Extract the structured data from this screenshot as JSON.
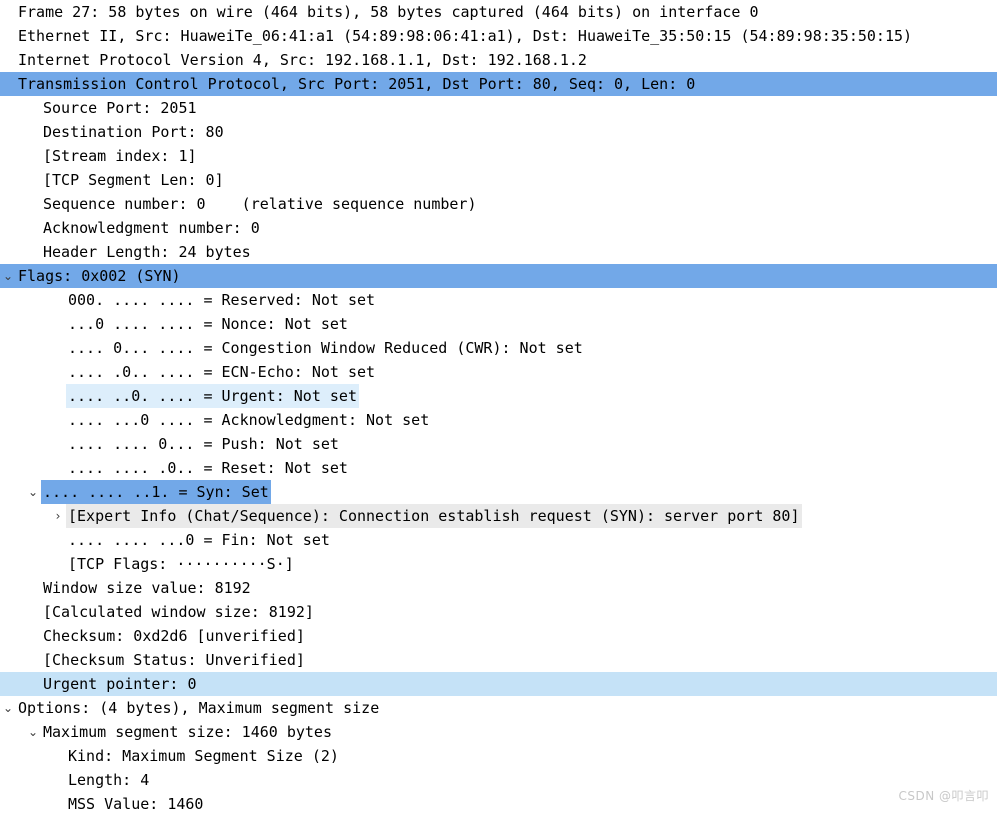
{
  "app": {
    "pane": "packet-details",
    "watermark": "CSDN @叩言叩"
  },
  "colors": {
    "selection_blue": "#72a8e8",
    "highlight_light_blue": "#c5e2f7",
    "highlight_pale_blue": "#ddeefb",
    "expert_gray": "#eaeaea",
    "text": "#000000",
    "background": "#ffffff"
  },
  "icons": {
    "expanded": "⌄",
    "collapsed": "›"
  },
  "rows": [
    {
      "id": "frame",
      "indent": 0,
      "twisty": "none",
      "highlight": "none",
      "text": "Frame 27: 58 bytes on wire (464 bits), 58 bytes captured (464 bits) on interface 0"
    },
    {
      "id": "ethernet",
      "indent": 0,
      "twisty": "none",
      "highlight": "none",
      "text": "Ethernet II, Src: HuaweiTe_06:41:a1 (54:89:98:06:41:a1), Dst: HuaweiTe_35:50:15 (54:89:98:35:50:15)"
    },
    {
      "id": "ipv4",
      "indent": 0,
      "twisty": "none",
      "highlight": "none",
      "text": "Internet Protocol Version 4, Src: 192.168.1.1, Dst: 192.168.1.2"
    },
    {
      "id": "tcp",
      "indent": 0,
      "twisty": "none",
      "highlight": "selected-full",
      "text": "Transmission Control Protocol, Src Port: 2051, Dst Port: 80, Seq: 0, Len: 0"
    },
    {
      "id": "source-port",
      "indent": 1,
      "twisty": "none",
      "highlight": "none",
      "text": "Source Port: 2051"
    },
    {
      "id": "destination-port",
      "indent": 1,
      "twisty": "none",
      "highlight": "none",
      "text": "Destination Port: 80"
    },
    {
      "id": "stream-index",
      "indent": 1,
      "twisty": "none",
      "highlight": "none",
      "text": "[Stream index: 1]"
    },
    {
      "id": "tcp-segment-len",
      "indent": 1,
      "twisty": "none",
      "highlight": "none",
      "text": "[TCP Segment Len: 0]"
    },
    {
      "id": "sequence-number",
      "indent": 1,
      "twisty": "none",
      "highlight": "none",
      "text": "Sequence number: 0    (relative sequence number)"
    },
    {
      "id": "acknowledgment-number",
      "indent": 1,
      "twisty": "none",
      "highlight": "none",
      "text": "Acknowledgment number: 0"
    },
    {
      "id": "header-length",
      "indent": 1,
      "twisty": "none",
      "highlight": "none",
      "text": "Header Length: 24 bytes"
    },
    {
      "id": "flags",
      "indent": 0,
      "twisty": "expanded",
      "highlight": "selected-full",
      "text": "Flags: 0x002 (SYN)"
    },
    {
      "id": "flag-reserved",
      "indent": 2,
      "twisty": "none",
      "highlight": "none",
      "text": "000. .... .... = Reserved: Not set"
    },
    {
      "id": "flag-nonce",
      "indent": 2,
      "twisty": "none",
      "highlight": "none",
      "text": "...0 .... .... = Nonce: Not set"
    },
    {
      "id": "flag-cwr",
      "indent": 2,
      "twisty": "none",
      "highlight": "none",
      "text": ".... 0... .... = Congestion Window Reduced (CWR): Not set"
    },
    {
      "id": "flag-ecn-echo",
      "indent": 2,
      "twisty": "none",
      "highlight": "none",
      "text": ".... .0.. .... = ECN-Echo: Not set"
    },
    {
      "id": "flag-urgent",
      "indent": 2,
      "twisty": "none",
      "highlight": "pale-inline",
      "text": ".... ..0. .... = Urgent: Not set"
    },
    {
      "id": "flag-acknowledgment",
      "indent": 2,
      "twisty": "none",
      "highlight": "none",
      "text": ".... ...0 .... = Acknowledgment: Not set"
    },
    {
      "id": "flag-push",
      "indent": 2,
      "twisty": "none",
      "highlight": "none",
      "text": ".... .... 0... = Push: Not set"
    },
    {
      "id": "flag-reset",
      "indent": 2,
      "twisty": "none",
      "highlight": "none",
      "text": ".... .... .0.. = Reset: Not set"
    },
    {
      "id": "flag-syn",
      "indent": 1,
      "twisty": "expanded",
      "highlight": "selected-inline",
      "text": ".... .... ..1. = Syn: Set"
    },
    {
      "id": "expert-info",
      "indent": 2,
      "twisty": "collapsed",
      "highlight": "gray-inline",
      "text": "[Expert Info (Chat/Sequence): Connection establish request (SYN): server port 80]"
    },
    {
      "id": "flag-fin",
      "indent": 2,
      "twisty": "none",
      "highlight": "none",
      "text": ".... .... ...0 = Fin: Not set"
    },
    {
      "id": "tcp-flags-summary",
      "indent": 2,
      "twisty": "none",
      "highlight": "none",
      "text": "[TCP Flags: ··········S·]"
    },
    {
      "id": "window-size-value",
      "indent": 1,
      "twisty": "none",
      "highlight": "none",
      "text": "Window size value: 8192"
    },
    {
      "id": "calculated-window-size",
      "indent": 1,
      "twisty": "none",
      "highlight": "none",
      "text": "[Calculated window size: 8192]"
    },
    {
      "id": "checksum",
      "indent": 1,
      "twisty": "none",
      "highlight": "none",
      "text": "Checksum: 0xd2d6 [unverified]"
    },
    {
      "id": "checksum-status",
      "indent": 1,
      "twisty": "none",
      "highlight": "none",
      "text": "[Checksum Status: Unverified]"
    },
    {
      "id": "urgent-pointer",
      "indent": 1,
      "twisty": "none",
      "highlight": "light-full",
      "text": "Urgent pointer: 0"
    },
    {
      "id": "options",
      "indent": 0,
      "twisty": "expanded",
      "highlight": "none",
      "text": "Options: (4 bytes), Maximum segment size"
    },
    {
      "id": "maximum-segment-size",
      "indent": 1,
      "twisty": "expanded",
      "highlight": "none",
      "text": "Maximum segment size: 1460 bytes"
    },
    {
      "id": "mss-kind",
      "indent": 2,
      "twisty": "none",
      "highlight": "none",
      "text": "Kind: Maximum Segment Size (2)"
    },
    {
      "id": "mss-length",
      "indent": 2,
      "twisty": "none",
      "highlight": "none",
      "text": "Length: 4"
    },
    {
      "id": "mss-value",
      "indent": 2,
      "twisty": "none",
      "highlight": "none",
      "text": "MSS Value: 1460"
    }
  ]
}
